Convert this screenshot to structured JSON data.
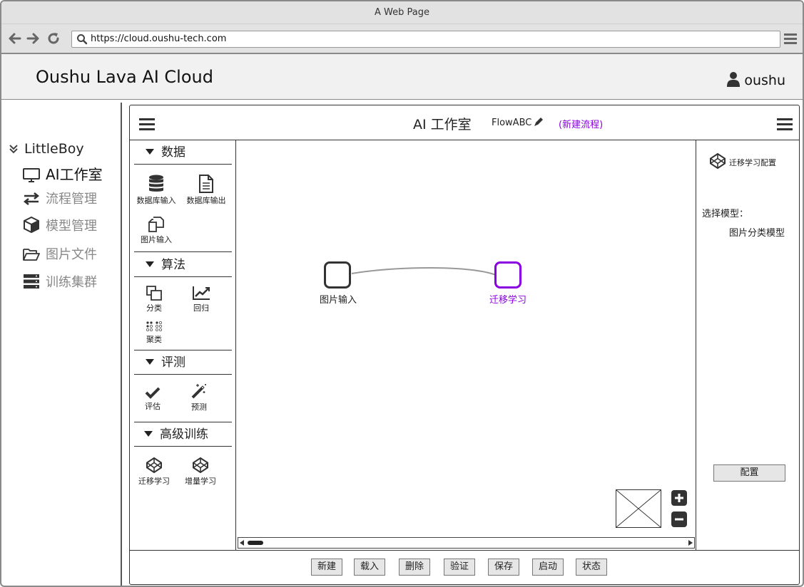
{
  "browser": {
    "title": "A Web Page",
    "url": "https://cloud.oushu-tech.com"
  },
  "header": {
    "app_title": "Oushu Lava AI Cloud",
    "username": "oushu"
  },
  "sidebar": {
    "project": "LittleBoy",
    "items": [
      {
        "label": "AI工作室",
        "icon": "monitor-icon",
        "active": true
      },
      {
        "label": "流程管理",
        "icon": "exchange-icon",
        "active": false
      },
      {
        "label": "模型管理",
        "icon": "cube-icon",
        "active": false
      },
      {
        "label": "图片文件",
        "icon": "folder-open-icon",
        "active": false
      },
      {
        "label": "训练集群",
        "icon": "server-icon",
        "active": false
      }
    ]
  },
  "studio": {
    "title": "AI 工作室",
    "flow_name": "FlowABC",
    "new_flow": "(新建流程)"
  },
  "palette": {
    "sections": [
      {
        "title": "数据",
        "tools": [
          "数据库输入",
          "数据库输出",
          "图片输入"
        ]
      },
      {
        "title": "算法",
        "tools": [
          "分类",
          "回归",
          "聚类"
        ]
      },
      {
        "title": "评测",
        "tools": [
          "评估",
          "预测"
        ]
      },
      {
        "title": "高级训练",
        "tools": [
          "迁移学习",
          "增量学习"
        ]
      }
    ]
  },
  "canvas": {
    "nodes": [
      {
        "label": "图片输入",
        "selected": false
      },
      {
        "label": "迁移学习",
        "selected": true
      }
    ]
  },
  "properties": {
    "title": "迁移学习配置",
    "model_label": "选择模型：",
    "model_value": "图片分类模型",
    "config_button": "配置"
  },
  "footer": {
    "buttons": [
      "新建",
      "载入",
      "删除",
      "验证",
      "保存",
      "启动",
      "状态"
    ]
  },
  "colors": {
    "accent": "#8a00e0",
    "border": "#333333",
    "chrome": "#e2e2e2"
  }
}
